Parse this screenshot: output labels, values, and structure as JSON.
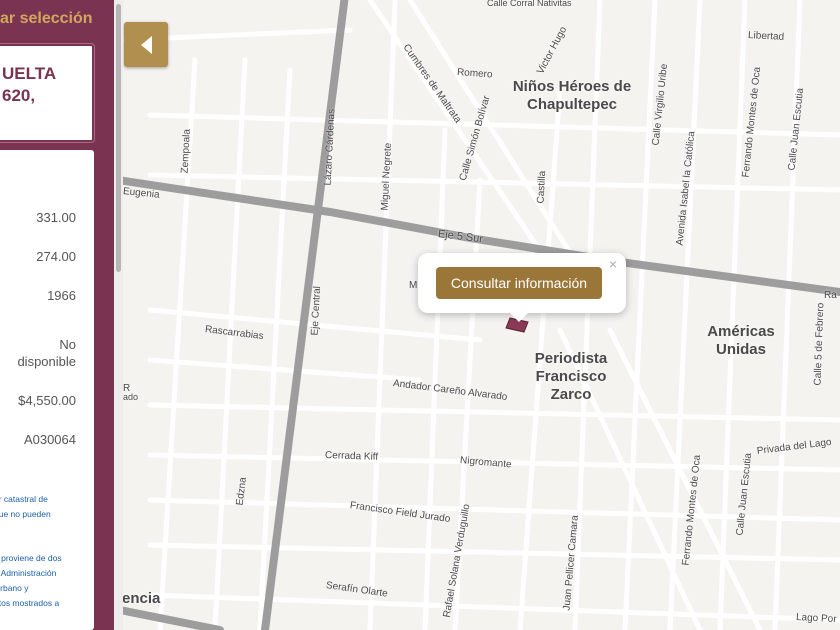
{
  "sidebar": {
    "title": "ar selección",
    "address": {
      "line1": "UELTA",
      "line2": "620,"
    },
    "values": [
      "331.00",
      "274.00",
      "1966",
      "No",
      "disponible",
      "$4,550.00",
      "A030064"
    ],
    "notes": [
      "or catastral de",
      "que no pueden",
      "a proviene de dos",
      "e Administración",
      "Urbano y",
      "atos mostrados a"
    ]
  },
  "popup": {
    "button_label": "Consultar información",
    "close": "×"
  },
  "map": {
    "neighborhoods": [
      {
        "id": "ninos",
        "lines": [
          "Niños Héroes de",
          "Chapultepec"
        ]
      },
      {
        "id": "periodista",
        "lines": [
          "Periodista",
          "Francisco",
          "Zarco"
        ]
      },
      {
        "id": "americas",
        "lines": [
          "Américas",
          "Unidas"
        ]
      }
    ],
    "bottom_left_label": "encia",
    "streets": [
      "Eje 5 Sur",
      "Eugenia",
      "Lázaro Cárdenas",
      "Eje Central",
      "Zempoala",
      "Miguel Negrete",
      "Calle Simón Bolívar",
      "Cumbres de Maltrata",
      "Victor Hugo",
      "Romero",
      "Castilla",
      "Calle Virgilio Uribe",
      "Avenida Isabel la Católica",
      "Ferrando Montes de Oca",
      "Calle Juan Escutia",
      "Libertad",
      "Calle 5 de Febrero",
      "Rascarrabias",
      "Andador Careño Alvarado",
      "Cerrada Kiff",
      "Nigromante",
      "Edzna",
      "Francisco Field Jurado",
      "Rafael Solana Verduguillo",
      "Juan Pellicer Camara",
      "Calle Juan Escutia",
      "Privada del Lago",
      "Serafín Olarte",
      "Lago Por",
      "Ferrando Montes de Oca",
      "Ra",
      "M",
      "R",
      "ado",
      "Calle Corral Nativitas"
    ]
  }
}
